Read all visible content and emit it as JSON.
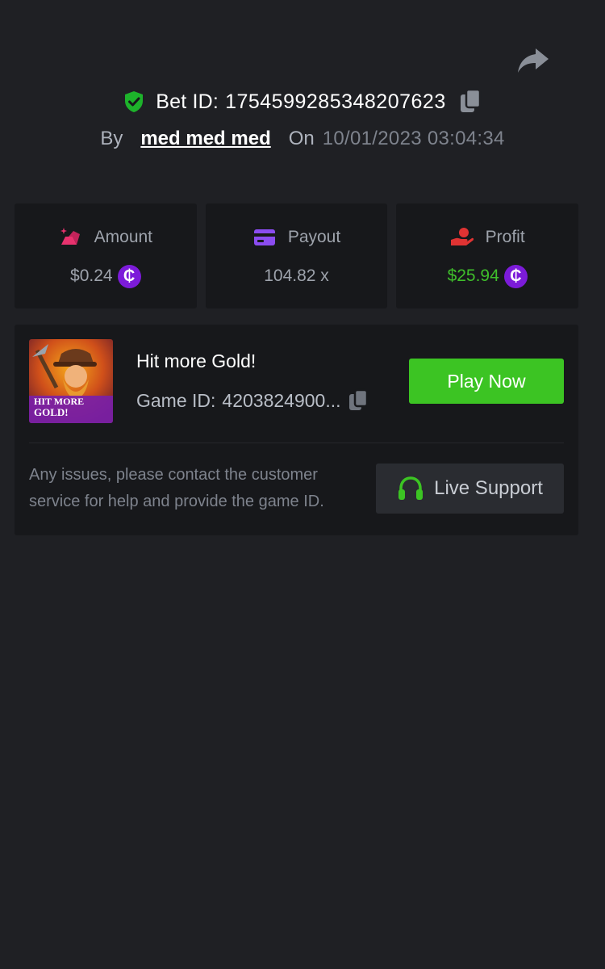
{
  "header": {
    "bet_id_label": "Bet ID:",
    "bet_id_value": "1754599285348207623",
    "by_label": "By",
    "username": "med med med",
    "on_label": "On",
    "datetime": "10/01/2023 03:04:34"
  },
  "stats": [
    {
      "label": "Amount",
      "value": "$0.24",
      "icon": "gold-bar-icon",
      "icon_color": "#e8326e",
      "has_coin": true,
      "value_color": "#9ea3ac"
    },
    {
      "label": "Payout",
      "value": "104.82 x",
      "icon": "card-icon",
      "icon_color": "#8b4cf0",
      "has_coin": false,
      "value_color": "#9ea3ac"
    },
    {
      "label": "Profit",
      "value": "$25.94",
      "icon": "hand-coin-icon",
      "icon_color": "#e03333",
      "has_coin": true,
      "value_color": "#3fbf2b"
    }
  ],
  "coin_symbol": "₵",
  "game": {
    "title": "Hit more Gold!",
    "id_label": "Game ID:",
    "id_value": "4203824900...",
    "thumb_text_line1": "HIT MORE",
    "thumb_text_line2": "GOLD!",
    "play_button_label": "Play Now"
  },
  "support": {
    "text": "Any issues, please contact the customer service for help and provide the game ID.",
    "button_label": "Live Support"
  },
  "colors": {
    "background": "#1f2024",
    "card": "#17181b",
    "accent_green": "#3cc423",
    "coin_purple": "#7c1bd9"
  }
}
